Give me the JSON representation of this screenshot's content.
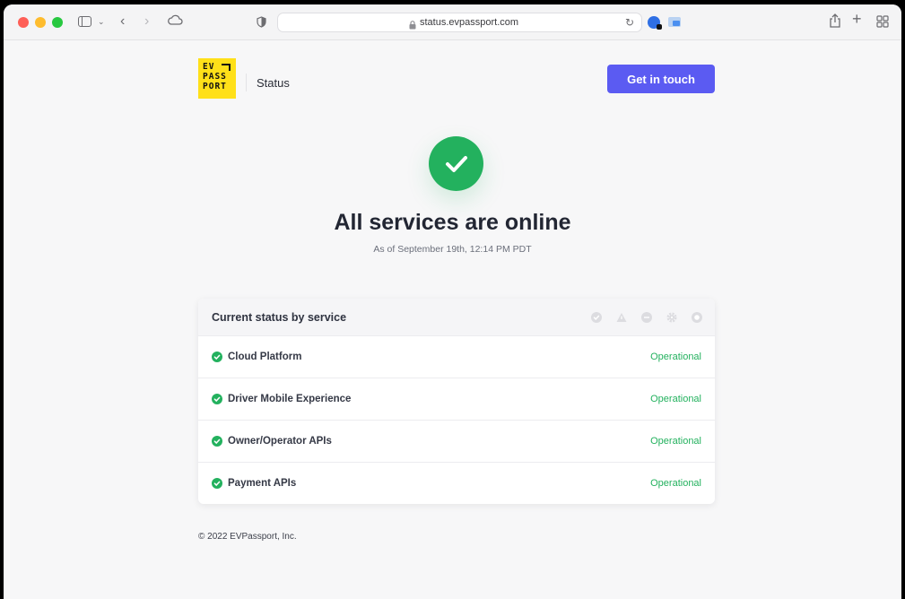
{
  "browser": {
    "url": "status.evpassport.com"
  },
  "header": {
    "logo_lines": [
      "EV",
      "PASS",
      "PORT"
    ],
    "title": "Status",
    "cta_label": "Get in touch"
  },
  "hero": {
    "title": "All services are online",
    "subtitle": "As of September 19th, 12:14 PM PDT"
  },
  "status_card": {
    "title": "Current status by service",
    "legend_icons": [
      "operational-icon",
      "warning-icon",
      "outage-icon",
      "maintenance-icon",
      "unknown-icon"
    ],
    "services": [
      {
        "name": "Cloud Platform",
        "status": "Operational"
      },
      {
        "name": "Driver Mobile Experience",
        "status": "Operational"
      },
      {
        "name": "Owner/Operator APIs",
        "status": "Operational"
      },
      {
        "name": "Payment APIs",
        "status": "Operational"
      }
    ]
  },
  "footer": {
    "copyright": "© 2022 EVPassport, Inc."
  },
  "colors": {
    "accent": "#5b5bf2",
    "success": "#23b15e",
    "logo_yellow": "#ffe019"
  }
}
